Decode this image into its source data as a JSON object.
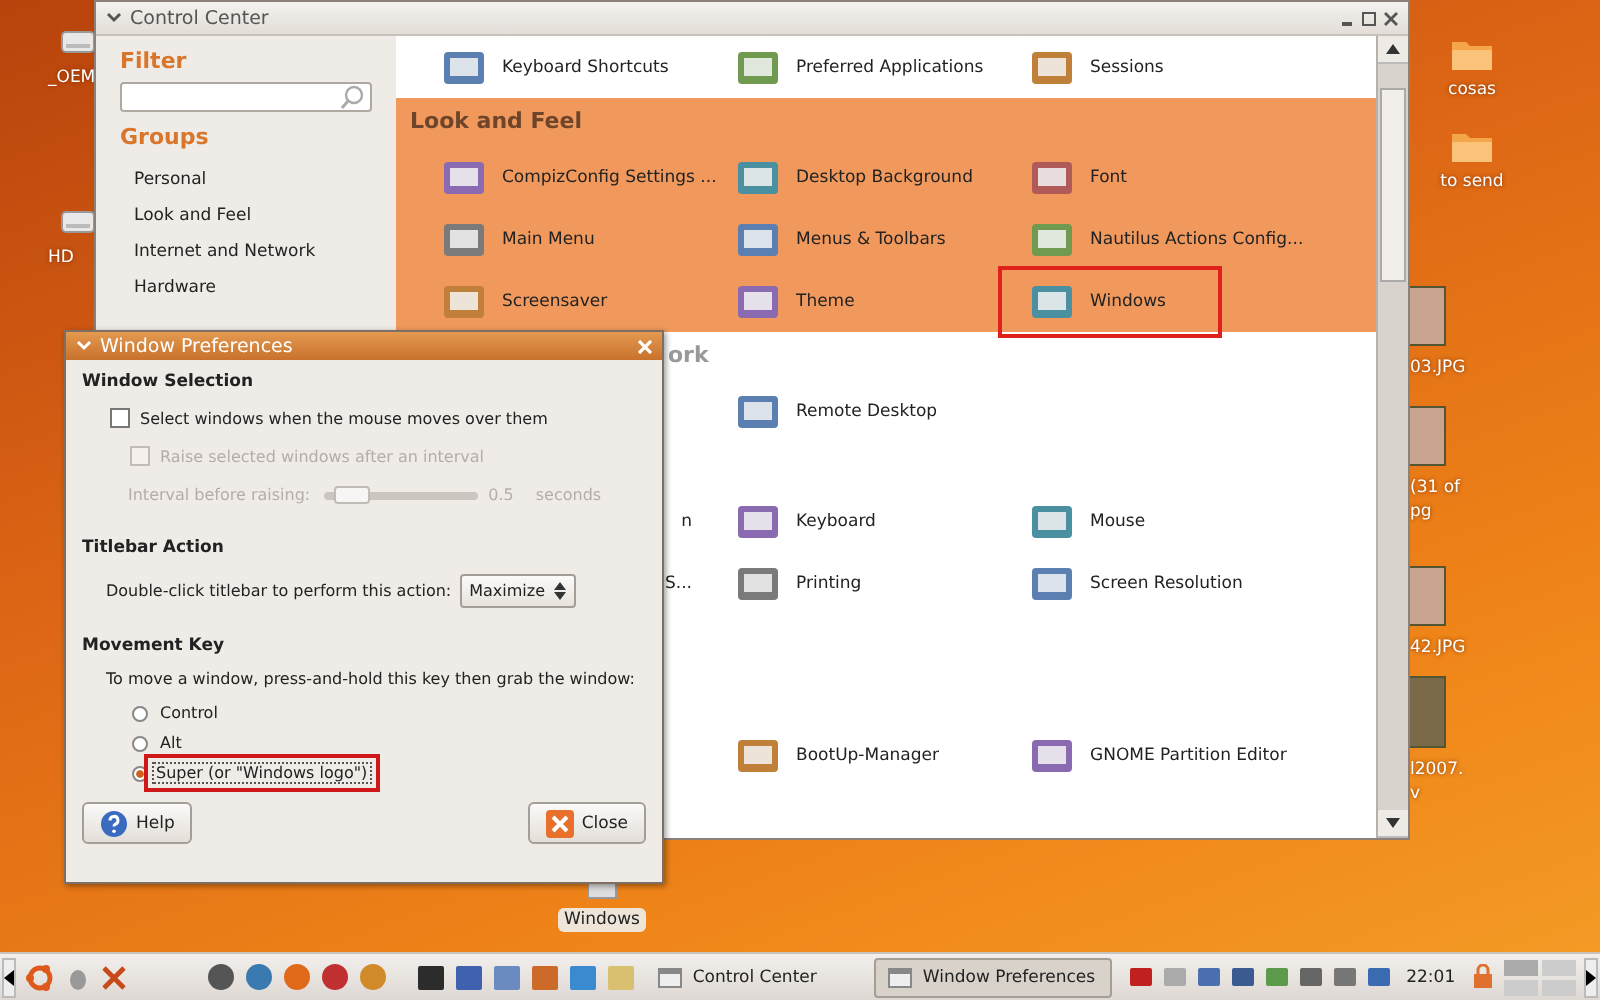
{
  "desktop": {
    "left_icons": [
      {
        "label": "_OEM"
      },
      {
        "label": "HD"
      }
    ],
    "right_icons": [
      {
        "kind": "folder",
        "lines": [
          "cosas"
        ]
      },
      {
        "kind": "folder",
        "lines": [
          "to send"
        ]
      },
      {
        "kind": "photo",
        "lines": [
          "03.JPG"
        ]
      },
      {
        "kind": "photo",
        "lines": [
          "(31 of",
          "pg"
        ]
      },
      {
        "kind": "photo",
        "lines": [
          "42.JPG"
        ]
      },
      {
        "kind": "video",
        "lines": [
          "l2007.",
          "v"
        ]
      }
    ],
    "drive": {
      "label": "Windows"
    }
  },
  "control_center": {
    "title": "Control Center",
    "filter": {
      "heading": "Filter"
    },
    "groups": {
      "heading": "Groups",
      "items": [
        "Personal",
        "Look and Feel",
        "Internet and Network",
        "Hardware"
      ]
    },
    "sections": [
      {
        "selected": false,
        "rows": [
          [
            {
              "kind": "app",
              "label": "Keyboard Shortcuts",
              "highlighted": false
            },
            {
              "kind": "app",
              "label": "Preferred Applications",
              "highlighted": false
            },
            {
              "kind": "app",
              "label": "Sessions",
              "highlighted": false
            }
          ]
        ]
      },
      {
        "title": "Look and Feel",
        "selected": true,
        "rows": [
          [
            {
              "kind": "app",
              "label": "CompizConfig Settings ...",
              "highlighted": false
            },
            {
              "kind": "app",
              "label": "Desktop Background",
              "highlighted": false
            },
            {
              "kind": "app",
              "label": "Font",
              "highlighted": false
            }
          ],
          [
            {
              "kind": "app",
              "label": "Main Menu",
              "highlighted": false
            },
            {
              "kind": "app",
              "label": "Menus & Toolbars",
              "highlighted": false
            },
            {
              "kind": "app",
              "label": "Nautilus Actions Config...",
              "highlighted": false
            }
          ],
          [
            {
              "kind": "app",
              "label": "Screensaver",
              "highlighted": false
            },
            {
              "kind": "app",
              "label": "Theme",
              "highlighted": false
            },
            {
              "kind": "app",
              "label": "Windows",
              "highlighted": true
            }
          ]
        ]
      },
      {
        "title": "ork",
        "selected": false,
        "rows": [
          [
            {
              "kind": "blank"
            },
            {
              "kind": "app",
              "label": "Remote Desktop",
              "highlighted": false
            }
          ]
        ]
      },
      {
        "selected": false,
        "rows": [
          [
            {
              "kind": "partial",
              "label": "n"
            },
            {
              "kind": "app",
              "label": "Keyboard",
              "highlighted": false
            },
            {
              "kind": "app",
              "label": "Mouse",
              "highlighted": false
            }
          ],
          [
            {
              "kind": "partial",
              "label": "S..."
            },
            {
              "kind": "app",
              "label": "Printing",
              "highlighted": false
            },
            {
              "kind": "app",
              "label": "Screen Resolution",
              "highlighted": false
            }
          ]
        ]
      },
      {
        "selected": false,
        "rows": [
          [
            {
              "kind": "blank"
            }
          ],
          [
            {
              "kind": "blank"
            },
            {
              "kind": "app",
              "label": "BootUp-Manager",
              "highlighted": false
            },
            {
              "kind": "app",
              "label": "GNOME Partition Editor",
              "highlighted": false
            }
          ]
        ]
      }
    ]
  },
  "window_preferences": {
    "title": "Window Preferences",
    "window_selection": {
      "heading": "Window Selection",
      "options": [
        {
          "label": "Select windows when the mouse moves over them",
          "checked": false,
          "disabled": false
        },
        {
          "label": "Raise selected windows after an interval",
          "checked": false,
          "disabled": true
        }
      ],
      "interval": {
        "label": "Interval before raising:",
        "level": 0.08,
        "reading": "0.5",
        "unit": "seconds",
        "disabled": true
      }
    },
    "titlebar_action": {
      "heading": "Titlebar Action",
      "label": "Double-click titlebar to perform this action:",
      "value": "Maximize"
    },
    "movement_key": {
      "heading": "Movement Key",
      "prompt": "To move a window, press-and-hold this key then grab the window:",
      "options": [
        {
          "label": "Control",
          "selected": false,
          "highlighted": false
        },
        {
          "label": "Alt",
          "selected": false,
          "highlighted": false
        },
        {
          "label": "Super (or \"Windows logo\")",
          "selected": true,
          "highlighted": true
        }
      ]
    },
    "buttons": [
      {
        "kind": "help",
        "label": "Help"
      },
      {
        "kind": "close",
        "label": "Close"
      }
    ]
  },
  "taskbar": {
    "tasks": [
      {
        "label": "Control Center",
        "selected": false
      },
      {
        "label": "Window Preferences",
        "selected": true
      }
    ],
    "clock": "22:01"
  }
}
